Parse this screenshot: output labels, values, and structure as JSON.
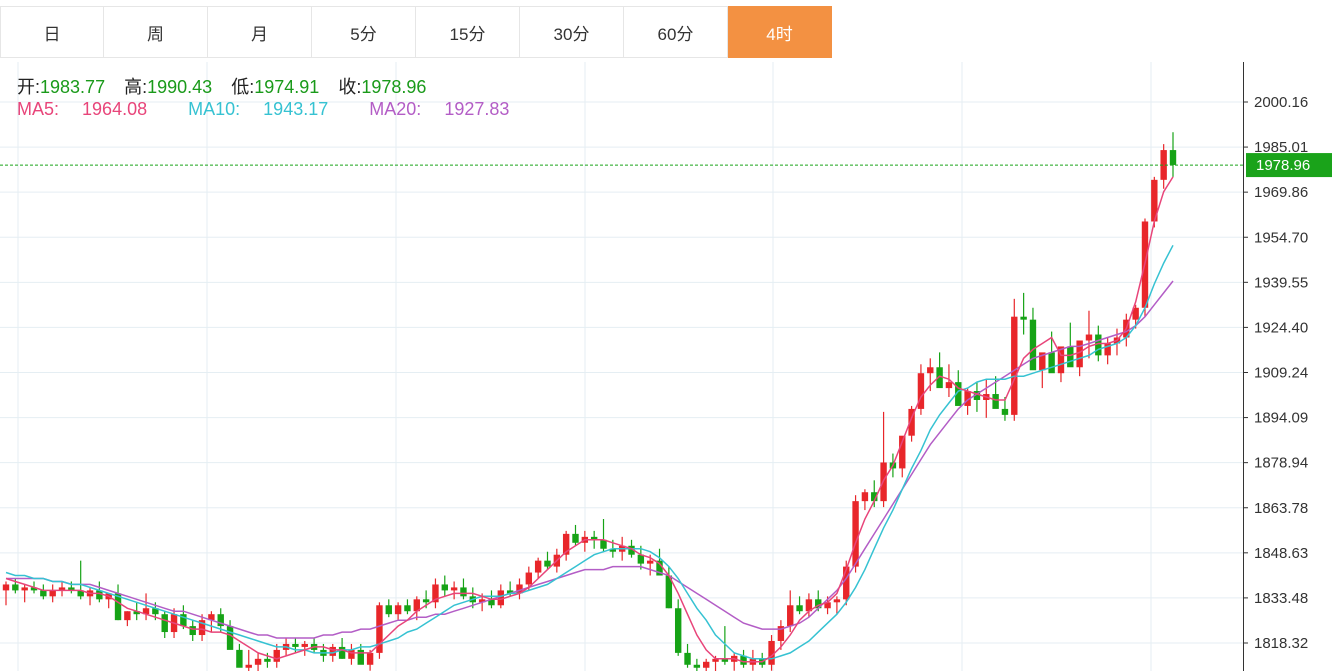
{
  "tabs": [
    {
      "label": "日",
      "active": false
    },
    {
      "label": "周",
      "active": false
    },
    {
      "label": "月",
      "active": false
    },
    {
      "label": "5分",
      "active": false
    },
    {
      "label": "15分",
      "active": false
    },
    {
      "label": "30分",
      "active": false
    },
    {
      "label": "60分",
      "active": false
    },
    {
      "label": "4时",
      "active": true
    }
  ],
  "ohlc": {
    "open_label": "开:",
    "open": "1983.77",
    "high_label": "高:",
    "high": "1990.43",
    "low_label": "低:",
    "low": "1974.91",
    "close_label": "收:",
    "close": "1978.96"
  },
  "ma": {
    "ma5_label": "MA5:",
    "ma5": "1964.08",
    "ma10_label": "MA10:",
    "ma10": "1943.17",
    "ma20_label": "MA20:",
    "ma20": "1927.83"
  },
  "colors": {
    "up": "#e8262a",
    "down": "#16a316",
    "ma5": "#e8457a",
    "ma10": "#36c2d2",
    "ma20": "#b35dc6",
    "accent": "#f39142",
    "price_line": "#1aa31a"
  },
  "chart_data": {
    "type": "candlestick",
    "y_ticks": [
      "2000.16",
      "1985.01",
      "1969.86",
      "1954.70",
      "1939.55",
      "1924.40",
      "1909.24",
      "1894.09",
      "1878.94",
      "1863.78",
      "1848.63",
      "1833.48",
      "1818.32"
    ],
    "ylim": [
      1814,
      2008
    ],
    "grid": true,
    "current_price": "1978.96",
    "candles": [
      [
        1836,
        1839,
        1831,
        1838
      ],
      [
        1838,
        1840,
        1835,
        1836
      ],
      [
        1836,
        1838,
        1832,
        1837
      ],
      [
        1837,
        1839,
        1835,
        1836
      ],
      [
        1836,
        1838,
        1833,
        1834
      ],
      [
        1834,
        1838,
        1832,
        1836
      ],
      [
        1836,
        1839,
        1834,
        1837
      ],
      [
        1837,
        1839,
        1835,
        1836
      ],
      [
        1836,
        1846,
        1833,
        1834
      ],
      [
        1834,
        1837,
        1831,
        1836
      ],
      [
        1836,
        1839,
        1832,
        1833
      ],
      [
        1833,
        1835,
        1830,
        1835
      ],
      [
        1835,
        1838,
        1826,
        1826
      ],
      [
        1826,
        1829,
        1824,
        1829
      ],
      [
        1829,
        1832,
        1826,
        1828
      ],
      [
        1828,
        1835,
        1826,
        1830
      ],
      [
        1830,
        1832,
        1826,
        1828
      ],
      [
        1828,
        1829,
        1820,
        1822
      ],
      [
        1822,
        1830,
        1820,
        1828
      ],
      [
        1828,
        1831,
        1823,
        1824
      ],
      [
        1824,
        1826,
        1819,
        1821
      ],
      [
        1821,
        1828,
        1819,
        1826
      ],
      [
        1826,
        1829,
        1822,
        1828
      ],
      [
        1828,
        1830,
        1822,
        1824
      ],
      [
        1824,
        1826,
        1818,
        1816
      ],
      [
        1816,
        1818,
        1812,
        1810
      ],
      [
        1810,
        1816,
        1808,
        1811
      ],
      [
        1811,
        1815,
        1808,
        1813
      ],
      [
        1813,
        1815,
        1810,
        1812
      ],
      [
        1812,
        1818,
        1810,
        1816
      ],
      [
        1816,
        1820,
        1814,
        1818
      ],
      [
        1818,
        1820,
        1815,
        1817
      ],
      [
        1817,
        1819,
        1814,
        1818
      ],
      [
        1818,
        1820,
        1815,
        1816
      ],
      [
        1816,
        1818,
        1812,
        1814
      ],
      [
        1814,
        1818,
        1812,
        1817
      ],
      [
        1817,
        1820,
        1813,
        1813
      ],
      [
        1813,
        1818,
        1811,
        1816
      ],
      [
        1816,
        1818,
        1812,
        1811
      ],
      [
        1811,
        1816,
        1809,
        1815
      ],
      [
        1815,
        1832,
        1813,
        1831
      ],
      [
        1831,
        1833,
        1827,
        1828
      ],
      [
        1828,
        1832,
        1826,
        1831
      ],
      [
        1831,
        1833,
        1828,
        1829
      ],
      [
        1829,
        1834,
        1826,
        1833
      ],
      [
        1833,
        1836,
        1830,
        1832
      ],
      [
        1832,
        1840,
        1830,
        1838
      ],
      [
        1838,
        1841,
        1834,
        1836
      ],
      [
        1836,
        1839,
        1833,
        1837
      ],
      [
        1837,
        1840,
        1833,
        1834
      ],
      [
        1834,
        1837,
        1830,
        1832
      ],
      [
        1832,
        1835,
        1829,
        1833
      ],
      [
        1833,
        1836,
        1830,
        1831
      ],
      [
        1831,
        1838,
        1830,
        1836
      ],
      [
        1836,
        1839,
        1834,
        1835
      ],
      [
        1835,
        1840,
        1833,
        1838
      ],
      [
        1838,
        1844,
        1836,
        1842
      ],
      [
        1842,
        1847,
        1840,
        1846
      ],
      [
        1846,
        1849,
        1843,
        1844
      ],
      [
        1844,
        1850,
        1842,
        1848
      ],
      [
        1848,
        1856,
        1846,
        1855
      ],
      [
        1855,
        1858,
        1851,
        1852
      ],
      [
        1852,
        1856,
        1849,
        1854
      ],
      [
        1854,
        1856,
        1850,
        1853
      ],
      [
        1853,
        1860,
        1849,
        1850
      ],
      [
        1850,
        1853,
        1847,
        1849
      ],
      [
        1849,
        1854,
        1846,
        1851
      ],
      [
        1851,
        1853,
        1847,
        1848
      ],
      [
        1848,
        1851,
        1843,
        1845
      ],
      [
        1845,
        1848,
        1841,
        1846
      ],
      [
        1846,
        1850,
        1842,
        1841
      ],
      [
        1841,
        1844,
        1830,
        1830
      ],
      [
        1830,
        1833,
        1814,
        1815
      ],
      [
        1815,
        1818,
        1810,
        1811
      ],
      [
        1811,
        1813,
        1808,
        1810
      ],
      [
        1810,
        1813,
        1807,
        1812
      ],
      [
        1812,
        1814,
        1808,
        1813
      ],
      [
        1813,
        1824,
        1811,
        1812
      ],
      [
        1812,
        1815,
        1809,
        1814
      ],
      [
        1814,
        1816,
        1810,
        1811
      ],
      [
        1811,
        1816,
        1809,
        1813
      ],
      [
        1813,
        1815,
        1810,
        1811
      ],
      [
        1811,
        1821,
        1809,
        1819
      ],
      [
        1819,
        1826,
        1816,
        1824
      ],
      [
        1824,
        1836,
        1822,
        1831
      ],
      [
        1831,
        1834,
        1828,
        1829
      ],
      [
        1829,
        1835,
        1827,
        1833
      ],
      [
        1833,
        1836,
        1829,
        1830
      ],
      [
        1830,
        1834,
        1828,
        1832
      ],
      [
        1832,
        1834,
        1828,
        1833
      ],
      [
        1833,
        1846,
        1831,
        1844
      ],
      [
        1844,
        1868,
        1842,
        1866
      ],
      [
        1866,
        1870,
        1863,
        1869
      ],
      [
        1869,
        1873,
        1864,
        1866
      ],
      [
        1866,
        1896,
        1864,
        1879
      ],
      [
        1879,
        1882,
        1874,
        1877
      ],
      [
        1877,
        1886,
        1874,
        1888
      ],
      [
        1888,
        1898,
        1886,
        1897
      ],
      [
        1897,
        1912,
        1895,
        1909
      ],
      [
        1909,
        1914,
        1903,
        1911
      ],
      [
        1911,
        1916,
        1907,
        1904
      ],
      [
        1904,
        1912,
        1901,
        1906
      ],
      [
        1906,
        1910,
        1900,
        1898
      ],
      [
        1898,
        1904,
        1895,
        1903
      ],
      [
        1903,
        1906,
        1896,
        1900
      ],
      [
        1900,
        1907,
        1894,
        1902
      ],
      [
        1902,
        1908,
        1898,
        1897
      ],
      [
        1897,
        1901,
        1893,
        1895
      ],
      [
        1895,
        1934,
        1893,
        1928
      ],
      [
        1928,
        1936,
        1922,
        1927
      ],
      [
        1927,
        1931,
        1914,
        1910
      ],
      [
        1910,
        1914,
        1904,
        1916
      ],
      [
        1916,
        1923,
        1912,
        1909
      ],
      [
        1909,
        1915,
        1906,
        1918
      ],
      [
        1918,
        1926,
        1914,
        1911
      ],
      [
        1911,
        1915,
        1908,
        1920
      ],
      [
        1920,
        1930,
        1914,
        1922
      ],
      [
        1922,
        1925,
        1913,
        1915
      ],
      [
        1915,
        1921,
        1912,
        1919
      ],
      [
        1919,
        1924,
        1915,
        1921
      ],
      [
        1921,
        1929,
        1918,
        1927
      ],
      [
        1927,
        1932,
        1924,
        1931
      ],
      [
        1931,
        1961,
        1928,
        1960
      ],
      [
        1960,
        1975,
        1958,
        1974
      ],
      [
        1974,
        1986,
        1971,
        1984
      ],
      [
        1984,
        1990,
        1975,
        1979
      ]
    ],
    "ma5": [
      1840,
      1839,
      1838,
      1837,
      1836,
      1836,
      1836,
      1836,
      1836,
      1835,
      1835,
      1834,
      1832,
      1830,
      1829,
      1828,
      1827,
      1826,
      1825,
      1824,
      1823,
      1823,
      1822,
      1822,
      1821,
      1819,
      1817,
      1815,
      1814,
      1813,
      1814,
      1815,
      1816,
      1817,
      1817,
      1816,
      1816,
      1815,
      1815,
      1815,
      1818,
      1821,
      1824,
      1826,
      1829,
      1831,
      1833,
      1834,
      1835,
      1835,
      1835,
      1834,
      1833,
      1833,
      1834,
      1835,
      1837,
      1840,
      1843,
      1846,
      1849,
      1851,
      1853,
      1853,
      1853,
      1852,
      1851,
      1850,
      1848,
      1847,
      1845,
      1841,
      1835,
      1828,
      1821,
      1816,
      1813,
      1813,
      1813,
      1812,
      1812,
      1812,
      1814,
      1817,
      1821,
      1826,
      1829,
      1831,
      1832,
      1835,
      1843,
      1852,
      1860,
      1866,
      1873,
      1878,
      1886,
      1894,
      1901,
      1905,
      1908,
      1907,
      1904,
      1903,
      1902,
      1901,
      1900,
      1900,
      1907,
      1914,
      1917,
      1919,
      1921,
      1915,
      1915,
      1916,
      1918,
      1919,
      1919,
      1920,
      1924,
      1933,
      1946,
      1960,
      1970,
      1975
    ],
    "ma10": [
      1842,
      1841,
      1841,
      1840,
      1840,
      1839,
      1839,
      1838,
      1838,
      1837,
      1836,
      1835,
      1834,
      1833,
      1832,
      1831,
      1830,
      1829,
      1828,
      1827,
      1826,
      1825,
      1824,
      1823,
      1822,
      1821,
      1820,
      1819,
      1818,
      1817,
      1817,
      1816,
      1816,
      1815,
      1815,
      1815,
      1816,
      1816,
      1817,
      1817,
      1818,
      1819,
      1820,
      1822,
      1823,
      1825,
      1827,
      1829,
      1831,
      1832,
      1833,
      1834,
      1834,
      1834,
      1835,
      1835,
      1836,
      1837,
      1838,
      1840,
      1842,
      1844,
      1846,
      1848,
      1849,
      1850,
      1850,
      1850,
      1850,
      1849,
      1847,
      1844,
      1840,
      1835,
      1830,
      1826,
      1821,
      1818,
      1815,
      1814,
      1813,
      1813,
      1813,
      1814,
      1815,
      1817,
      1819,
      1822,
      1825,
      1828,
      1832,
      1837,
      1843,
      1850,
      1857,
      1863,
      1870,
      1877,
      1883,
      1890,
      1895,
      1899,
      1903,
      1904,
      1906,
      1907,
      1907,
      1907,
      1908,
      1908,
      1909,
      1910,
      1911,
      1912,
      1913,
      1914,
      1915,
      1917,
      1918,
      1919,
      1921,
      1925,
      1931,
      1939,
      1946,
      1952
    ],
    "ma20": [
      1840,
      1840,
      1840,
      1840,
      1840,
      1839,
      1839,
      1838,
      1838,
      1838,
      1837,
      1836,
      1835,
      1834,
      1833,
      1832,
      1831,
      1830,
      1829,
      1829,
      1828,
      1827,
      1826,
      1825,
      1824,
      1823,
      1822,
      1821,
      1821,
      1820,
      1820,
      1820,
      1820,
      1820,
      1821,
      1821,
      1822,
      1822,
      1823,
      1823,
      1824,
      1825,
      1826,
      1826,
      1827,
      1827,
      1828,
      1828,
      1829,
      1830,
      1831,
      1832,
      1833,
      1834,
      1835,
      1836,
      1837,
      1838,
      1839,
      1840,
      1841,
      1842,
      1843,
      1843,
      1843,
      1844,
      1844,
      1844,
      1844,
      1843,
      1842,
      1841,
      1839,
      1837,
      1835,
      1833,
      1831,
      1829,
      1827,
      1825,
      1824,
      1823,
      1823,
      1823,
      1824,
      1825,
      1827,
      1830,
      1833,
      1836,
      1840,
      1845,
      1850,
      1855,
      1860,
      1865,
      1870,
      1875,
      1880,
      1885,
      1889,
      1893,
      1897,
      1900,
      1902,
      1904,
      1906,
      1908,
      1910,
      1912,
      1914,
      1915,
      1916,
      1917,
      1918,
      1918,
      1919,
      1920,
      1921,
      1922,
      1923,
      1925,
      1928,
      1932,
      1936,
      1940
    ]
  }
}
